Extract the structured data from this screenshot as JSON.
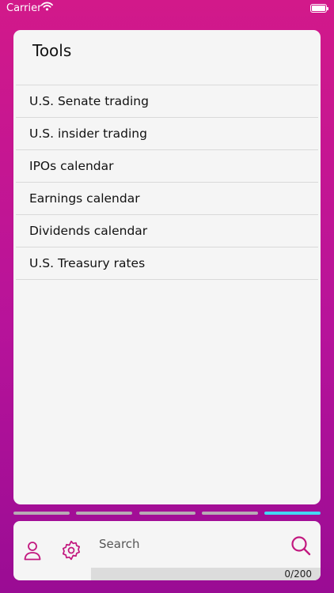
{
  "status_bar": {
    "carrier": "Carrier"
  },
  "tools": {
    "title": "Tools",
    "items": [
      {
        "label": "U.S. Senate trading"
      },
      {
        "label": "U.S. insider trading"
      },
      {
        "label": "IPOs calendar"
      },
      {
        "label": "Earnings calendar"
      },
      {
        "label": "Dividends calendar"
      },
      {
        "label": "U.S. Treasury rates"
      }
    ]
  },
  "pager": {
    "count": 5,
    "active_index": 4,
    "active_color": "#43d7f4"
  },
  "bottom_bar": {
    "search_placeholder": "Search",
    "search_value": "",
    "char_count": "0/200",
    "accent_color": "#c2187f",
    "icons": [
      "person-icon",
      "gear-icon",
      "search-icon"
    ]
  }
}
